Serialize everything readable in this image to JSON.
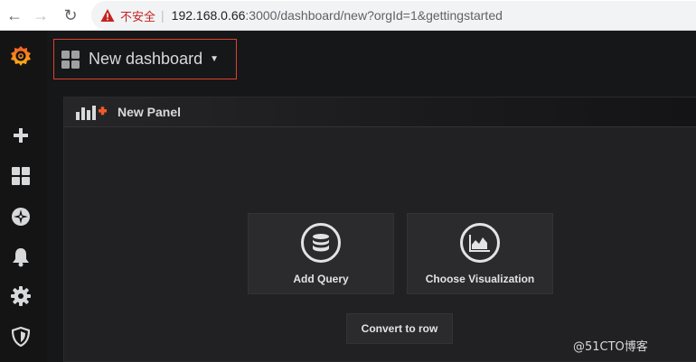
{
  "browser": {
    "back_glyph": "←",
    "forward_glyph": "→",
    "reload_glyph": "↻",
    "insecure_label": "不安全",
    "separator": "|",
    "url_host": "192.168.0.66",
    "url_path": ":3000/dashboard/new?orgId=1&gettingstarted"
  },
  "sidebar": {
    "items": [
      {
        "icon": "grafana-logo-icon"
      },
      {
        "icon": "plus-icon"
      },
      {
        "icon": "dashboards-icon"
      },
      {
        "icon": "explore-compass-icon"
      },
      {
        "icon": "alerting-bell-icon"
      },
      {
        "icon": "configuration-gear-icon"
      },
      {
        "icon": "server-admin-shield-icon"
      }
    ]
  },
  "header": {
    "dashboard_title": "New dashboard",
    "caret": "▼"
  },
  "panel": {
    "title": "New Panel",
    "add_query_label": "Add Query",
    "choose_visualization_label": "Choose Visualization",
    "convert_to_row_label": "Convert to row"
  },
  "watermark": "@51CTO博客",
  "colors": {
    "accent": "#f05a28",
    "warning": "#c5221f",
    "highlight_border": "#e0402c",
    "background": "#161719",
    "panel_bg": "#212124"
  }
}
